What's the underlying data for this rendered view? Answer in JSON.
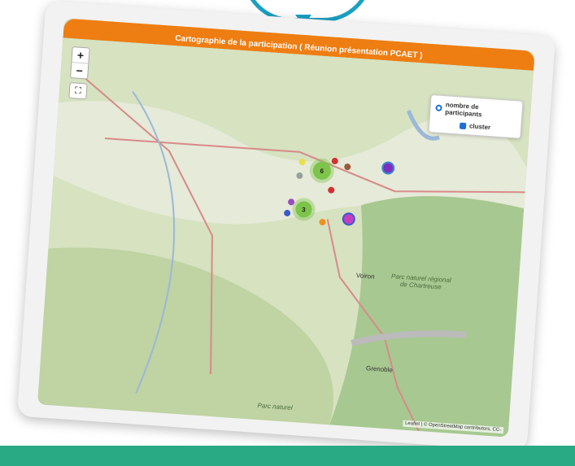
{
  "title": "Cartographie de la participation ( Réunion présentation PCAET )",
  "zoom": {
    "in_label": "+",
    "out_label": "−"
  },
  "fullscreen_label": "⛶",
  "legend": {
    "radio_label": "nombre de participants",
    "checkbox_label": "cluster"
  },
  "attribution": "Leaflet | © OpenStreetMap contributors, CC-",
  "map_labels": {
    "chartreuse": "Parc naturel régional de Chartreuse",
    "vercors": "Parc naturel",
    "grenoble": "Grenoble",
    "voiron": "Voiron"
  },
  "clusters": [
    {
      "label": "6",
      "color": "#7cc44a"
    },
    {
      "label": "3",
      "color": "#7cc44a"
    }
  ],
  "colors": {
    "title_bar": "#ee7d12",
    "bottom_band": "#2aa985",
    "bubble": "#1aa0c2"
  }
}
